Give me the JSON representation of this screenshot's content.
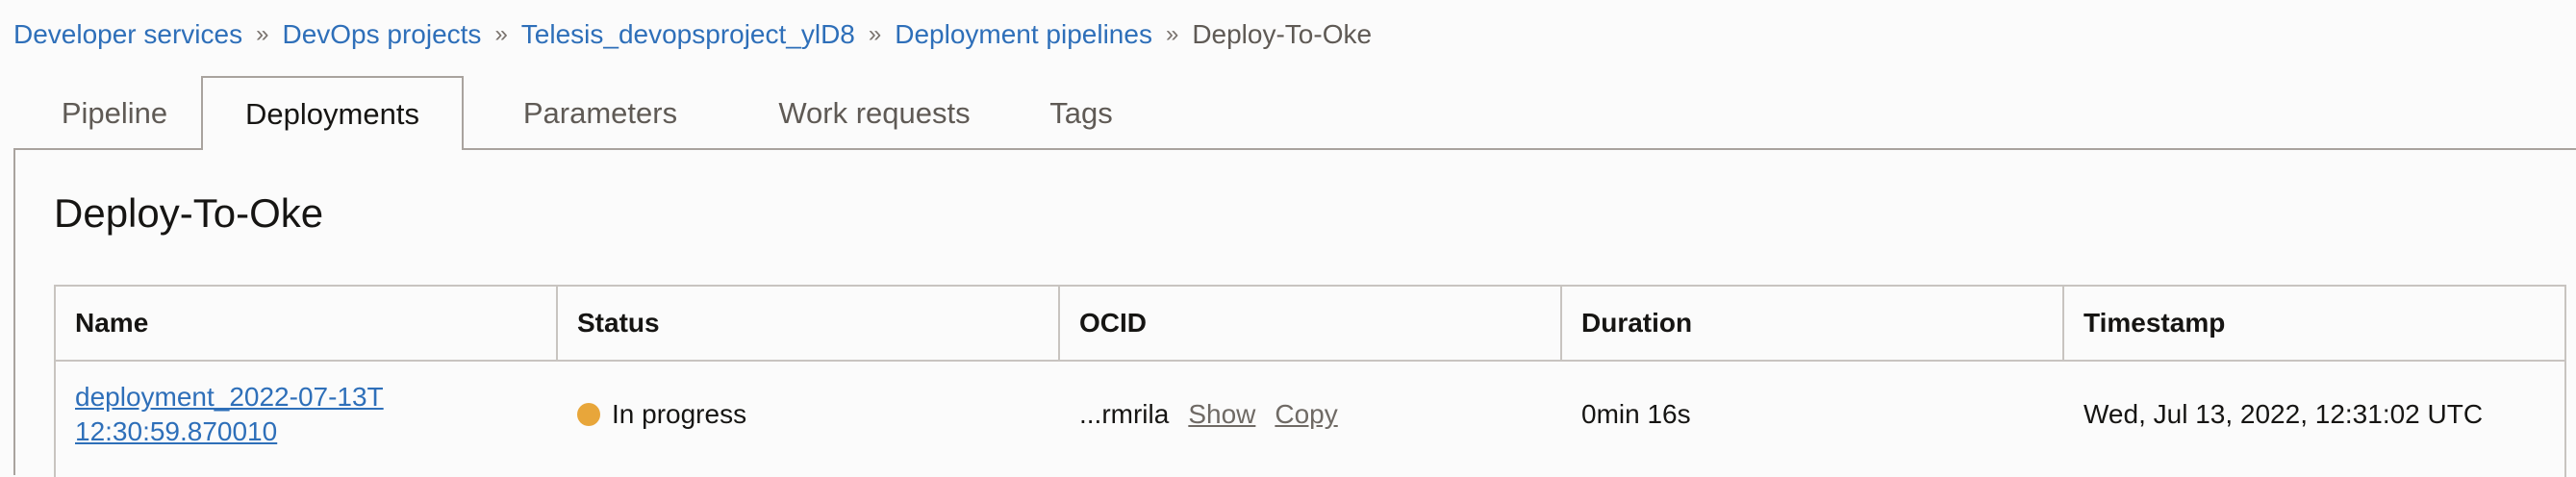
{
  "breadcrumb": {
    "items": [
      "Developer services",
      "DevOps projects",
      "Telesis_devopsproject_ylD8",
      "Deployment pipelines"
    ],
    "current": "Deploy-To-Oke",
    "separator": "»"
  },
  "tabs": [
    {
      "label": "Pipeline",
      "active": false
    },
    {
      "label": "Deployments",
      "active": true
    },
    {
      "label": "Parameters",
      "active": false
    },
    {
      "label": "Work requests",
      "active": false
    },
    {
      "label": "Tags",
      "active": false
    }
  ],
  "page_title": "Deploy-To-Oke",
  "table": {
    "headers": [
      "Name",
      "Status",
      "OCID",
      "Duration",
      "Timestamp"
    ],
    "rows": [
      {
        "name": "deployment_2022-07-13T12:30:59.870010",
        "status": "In progress",
        "status_color": "#e8a63a",
        "ocid": "...rmrila",
        "ocid_show": "Show",
        "ocid_copy": "Copy",
        "duration": "0min 16s",
        "timestamp": "Wed, Jul 13, 2022, 12:31:02 UTC"
      }
    ]
  },
  "colors": {
    "link": "#2e6fb9",
    "text": "#161513",
    "muted": "#5f5a55",
    "border": "#a9a39e"
  }
}
